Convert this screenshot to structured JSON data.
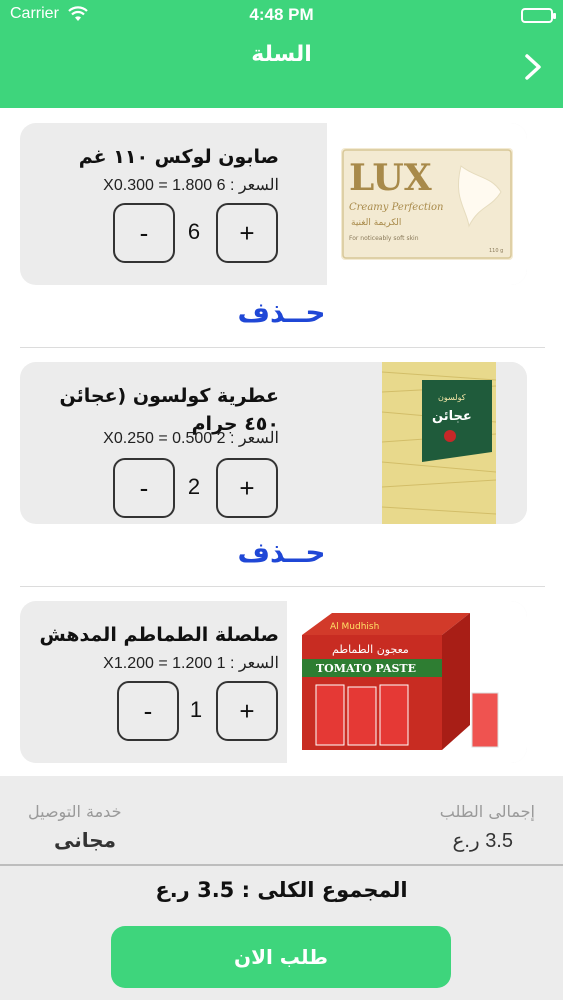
{
  "status_bar": {
    "carrier": "Carrier",
    "time": "4:48 PM"
  },
  "header": {
    "title": "السلة"
  },
  "items": [
    {
      "name": "صابون لوكس ١١٠ غم",
      "price_line": "السعر : 6 X0.300 = 1.800",
      "quantity": "6",
      "minus_label": "-",
      "plus_label": "+",
      "delete_label": "حــذف",
      "image": {
        "brand": "LUX",
        "subtitle": "Creamy Perfection",
        "arabic": "الكريمة الغنية",
        "note": "For noticeably soft skin",
        "weight": "110 g"
      }
    },
    {
      "name": "عطرية كولسون (عجائن ٤٥٠ جرام",
      "price_line": "السعر : 2 X0.250 = 0.500",
      "quantity": "2",
      "minus_label": "-",
      "plus_label": "+",
      "delete_label": "حــذف",
      "image": {
        "brand": "كولسون",
        "label": "عجائن"
      }
    },
    {
      "name": "صلصلة الطماطم المدهش",
      "price_line": "السعر : 1 X1.200 = 1.200",
      "quantity": "1",
      "minus_label": "-",
      "plus_label": "+",
      "image": {
        "brand": "Al Mudhish",
        "arabic": "معجون الطماطم",
        "label": "TOMATO PASTE"
      }
    }
  ],
  "summary": {
    "order_total_label": "إجمالى الطلب",
    "order_total_value": "3.5 ر.ع",
    "delivery_label": "خدمة التوصيل",
    "delivery_value": "مجانى"
  },
  "footer": {
    "grand_total": "المجموع الكلى : 3.5 ر.ع",
    "order_button": "طلب الان"
  },
  "colors": {
    "accent": "#3ed57c",
    "delete_text": "#1f47d6",
    "card_bg": "#ececec"
  }
}
